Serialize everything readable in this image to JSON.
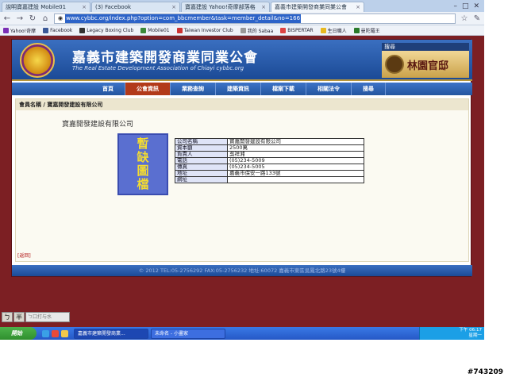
{
  "browser": {
    "tabs": [
      {
        "label": "說明寶嘉建設 Mobile01"
      },
      {
        "label": "(3) Facebook"
      },
      {
        "label": "寶嘉建設 Yahoo!奇摩部落格"
      },
      {
        "label": "嘉義市建築開發商業同業公會"
      }
    ],
    "url": "www.cybbc.org/index.php?option=com_bbcmember&task=member_detail&no=166",
    "bookmarks": [
      "Yahoo!奇摩",
      "Facebook",
      "Legacy Boxing Club",
      "Mobile01",
      "Taiwan Investor Club",
      "我的 Sabaa",
      "BISPERTAR",
      "生日職人",
      "曼陀羅王"
    ]
  },
  "site": {
    "title": "嘉義市建築開發商業同業公會",
    "subtitle": "The Real Estate Development Association of Chiayi   cybbc.org",
    "ad_label": "搜尋",
    "ad_text": "林園官邸",
    "nav": [
      "首頁",
      "公會資訊",
      "業務查詢",
      "建築資訊",
      "檔案下載",
      "相關法令",
      "搜尋"
    ],
    "active_nav": 1
  },
  "member": {
    "breadcrumb": "會員名稱 / 寶嘉開發建設有限公司",
    "company_heading": "寶嘉開發建設有限公司",
    "photo_text": [
      "暫",
      "缺",
      "圖",
      "檔"
    ],
    "rows": [
      {
        "k": "公司名稱",
        "v": "寶嘉開發建設有限公司"
      },
      {
        "k": "資本額",
        "v": "2500萬"
      },
      {
        "k": "負責人",
        "v": "吳祥湘"
      },
      {
        "k": "電話",
        "v": "(05)234-5009"
      },
      {
        "k": "傳真",
        "v": "(05)234-5005"
      },
      {
        "k": "地址",
        "v": "嘉義市保安一路133號"
      },
      {
        "k": "網址",
        "v": ""
      }
    ],
    "back_link": "[返回]"
  },
  "footer": "© 2012 TEL:05-2756292 FAX:05-2756232 地址:60072 嘉義市東區吳鳳北路23號4樓",
  "ime": {
    "buttons": [
      "ㄅ",
      "半"
    ],
    "text": "ㄅ口打与水"
  },
  "taskbar": {
    "start": "開始",
    "tasks": [
      "嘉義市建築開發商業...",
      "未命名 - 小畫家"
    ],
    "clock": "下午 06:17",
    "day": "星期一"
  },
  "watermark": "#743209",
  "colors": {
    "page_bg": "#7c1f23",
    "banner": "#2b5fae",
    "nav_active": "#b23a1a"
  }
}
